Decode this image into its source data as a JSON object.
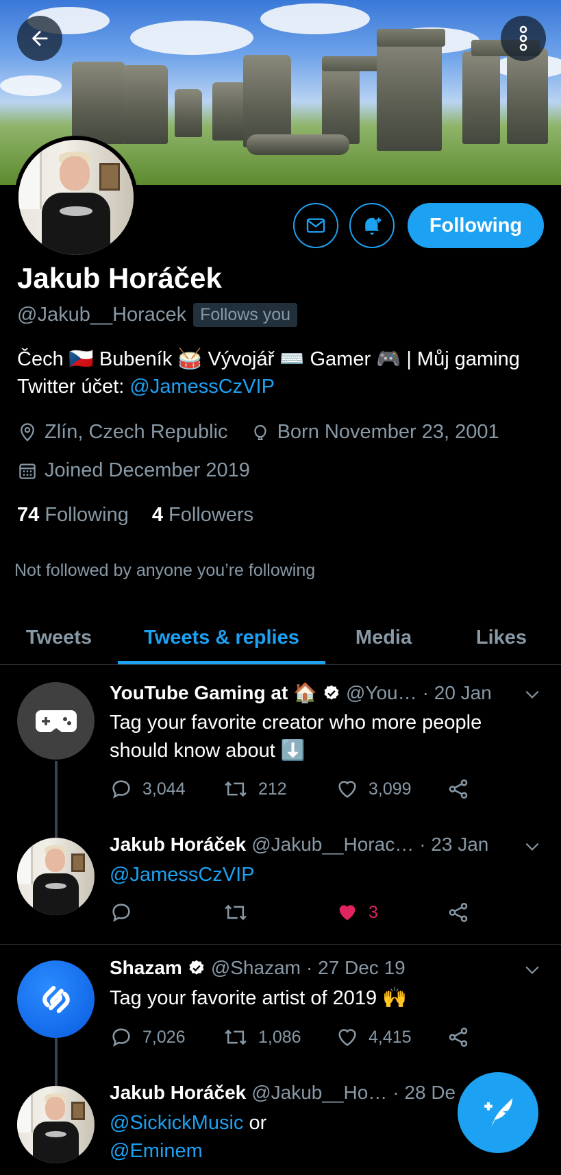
{
  "profile": {
    "name": "Jakub Horáček",
    "handle": "@Jakub__Horacek",
    "follows_you": "Follows you",
    "following_button": "Following",
    "bio_text": "Čech 🇨🇿 Bubeník 🥁 Vývojář ⌨️ Gamer 🎮  |  Můj gaming Twitter účet: ",
    "bio_link": "@JamessCzVIP",
    "location": "Zlín, Czech Republic",
    "born": "Born November 23, 2001",
    "joined": "Joined December 2019",
    "following_count": "74",
    "following_label": "Following",
    "followers_count": "4",
    "followers_label": "Followers",
    "not_followed": "Not followed by anyone you’re following"
  },
  "tabs": [
    "Tweets",
    "Tweets & replies",
    "Media",
    "Likes"
  ],
  "active_tab": "Tweets & replies",
  "tweets": [
    {
      "name": "YouTube Gaming at 🏠",
      "verified": true,
      "handle": "@You…",
      "time": "· 20 Jan",
      "text": "Tag your favorite creator who more people should know about ⬇️",
      "replies": "3,044",
      "retweets": "212",
      "likes": "3,099",
      "avatar": "youtube-gaming"
    },
    {
      "name": "Jakub Horáček",
      "handle": "@Jakub__Horac…",
      "time": "· 23 Jan",
      "text": "@JamessCzVIP",
      "replies": "",
      "retweets": "",
      "likes": "3",
      "liked": true,
      "avatar": "user"
    },
    {
      "name": "Shazam",
      "verified": true,
      "handle": "@Shazam",
      "time": "· 27 Dec 19",
      "text": "Tag your favorite artist of 2019 🙌",
      "replies": "7,026",
      "retweets": "1,086",
      "likes": "4,415",
      "avatar": "shazam"
    },
    {
      "name": "Jakub Horáček",
      "handle": "@Jakub__Ho…",
      "time": "· 28 De",
      "text_link1": "@SickickMusic",
      "text_mid": " or",
      "text_link2": "@Eminem",
      "avatar": "user"
    }
  ],
  "colors": {
    "accent": "#1da1f2",
    "like": "#e0245e",
    "muted": "#8899a6",
    "background": "#000000"
  }
}
